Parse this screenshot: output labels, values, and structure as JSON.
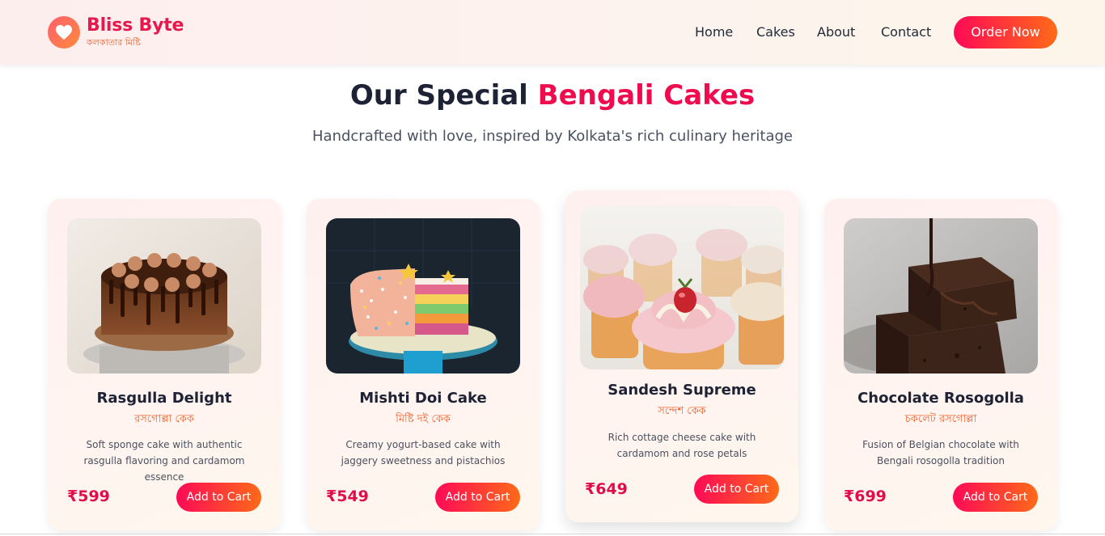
{
  "brand": {
    "name": "Bliss Byte",
    "tagline": "কলকাতার মিষ্টি",
    "logo_icon": "heart-icon",
    "colors": {
      "primary": "#e8174d",
      "accent": "#f0602a"
    }
  },
  "nav": {
    "items": [
      "Home",
      "Cakes",
      "About",
      "Contact"
    ],
    "cta": "Order Now"
  },
  "section": {
    "title_main": "Our Special",
    "title_accent": "Bengali Cakes",
    "subtitle": "Handcrafted with love, inspired by Kolkata's rich culinary heritage"
  },
  "cards": [
    {
      "title": "Rasgulla Delight",
      "bengali": "রসগোল্লা কেক",
      "desc": "Soft sponge cake with authentic rasgulla flavoring and cardamom essence",
      "price": "₹599",
      "button": "Add to Cart",
      "image": "chocolate-drip-cake-photo"
    },
    {
      "title": "Mishti Doi Cake",
      "bengali": "মিষ্টি দই কেক",
      "desc": "Creamy yogurt-based cake with jaggery sweetness and pistachios",
      "price": "₹549",
      "button": "Add to Cart",
      "image": "rainbow-sprinkle-cake-photo"
    },
    {
      "title": "Sandesh Supreme",
      "bengali": "সন্দেশ কেক",
      "desc": "Rich cottage cheese cake with cardamom and rose petals",
      "price": "₹649",
      "button": "Add to Cart",
      "image": "cupcakes-photo"
    },
    {
      "title": "Chocolate Rosogolla",
      "bengali": "চকলেট রসগোল্লা",
      "desc": "Fusion of Belgian chocolate with Bengali rosogolla tradition",
      "price": "₹699",
      "button": "Add to Cart",
      "image": "chocolate-brownie-photo"
    }
  ]
}
